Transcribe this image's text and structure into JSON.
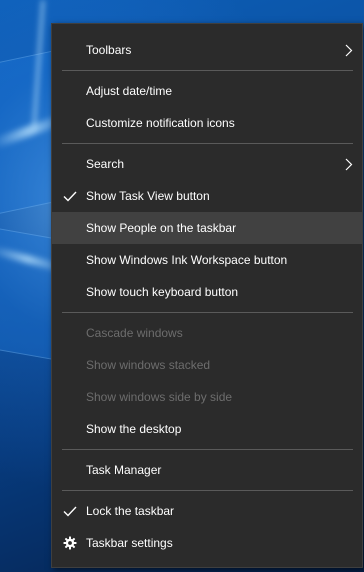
{
  "context_menu": {
    "items": [
      {
        "label": "Toolbars",
        "submenu_icon": "chevron-right-icon"
      },
      {
        "label": "Adjust date/time"
      },
      {
        "label": "Customize notification icons"
      },
      {
        "label": "Search",
        "submenu_icon": "chevron-right-icon"
      },
      {
        "label": "Show Task View button",
        "checked": true,
        "lead_icon": "checkmark-icon"
      },
      {
        "label": "Show People on the taskbar",
        "highlighted": true
      },
      {
        "label": "Show Windows Ink Workspace button"
      },
      {
        "label": "Show touch keyboard button"
      },
      {
        "label": "Cascade windows",
        "disabled": true
      },
      {
        "label": "Show windows stacked",
        "disabled": true
      },
      {
        "label": "Show windows side by side",
        "disabled": true
      },
      {
        "label": "Show the desktop"
      },
      {
        "label": "Task Manager"
      },
      {
        "label": "Lock the taskbar",
        "checked": true,
        "lead_icon": "checkmark-icon"
      },
      {
        "label": "Taskbar settings",
        "lead_icon": "gear-icon"
      }
    ]
  },
  "colors": {
    "menu_background": "#2b2b2b",
    "highlight": "#414141",
    "text": "#ffffff",
    "disabled_text": "#6d6d6d",
    "separator": "#5a5a5a"
  }
}
